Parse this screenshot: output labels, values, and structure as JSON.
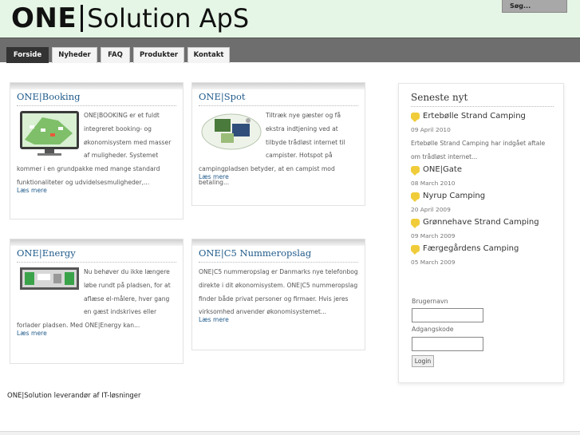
{
  "header": {
    "logo_bold": "ONE",
    "logo_rest": "Solution ApS",
    "search_label": "Søg..."
  },
  "nav": {
    "tabs": [
      {
        "label": "Forside",
        "active": true
      },
      {
        "label": "Nyheder",
        "active": false
      },
      {
        "label": "FAQ",
        "active": false
      },
      {
        "label": "Produkter",
        "active": false
      },
      {
        "label": "Kontakt",
        "active": false
      }
    ]
  },
  "products": [
    {
      "title": "ONE|Booking",
      "text": "ONE|BOOKING er et fuldt integreret booking- og økonomisystem med masser af muligheder. Systemet kommer i en grundpakke med mange standard funktionaliteter og udvidelsesmuligheder,...",
      "more": "Læs mere",
      "image": "booking-monitor-icon"
    },
    {
      "title": "ONE|Spot",
      "text": "Tiltræk nye gæster og få ekstra indtjening ved at tilbyde trådløst internet til campister. Hotspot på campingpladsen betyder, at en campist mod betaling...",
      "more": "Læs mere",
      "image": "spot-icon"
    },
    {
      "title": "ONE|Energy",
      "text": "Nu behøver du ikke længere løbe rundt på pladsen, for at aflæse el-målere, hver gang en gæst indskrives eller forlader pladsen. Med ONE|Energy kan...",
      "more": "Læs mere",
      "image": "energy-meter-icon"
    },
    {
      "title": "ONE|C5 Nummeropslag",
      "text": "ONE|C5 nummeropslag er Danmarks nye telefonbog direkte i dit økonomisystem. ONE|C5 nummeropslag finder både privat personer og firmaer. Hvis jeres virksomhed anvender økonomisystemet...",
      "more": "Læs mere"
    }
  ],
  "sidebar": {
    "title": "Seneste nyt",
    "news": [
      {
        "title": "Ertebølle Strand Camping",
        "date": "09 April 2010",
        "excerpt": "Ertebølle Strand Camping har indgået aftale om trådløst internet..."
      },
      {
        "title": "ONE|Gate",
        "date": "08 March 2010"
      },
      {
        "title": "Nyrup Camping",
        "date": "20 April 2009"
      },
      {
        "title": "Grønnehave Strand Camping",
        "date": "09 March 2009"
      },
      {
        "title": "Færgegårdens Camping",
        "date": "05 March 2009"
      }
    ],
    "login": {
      "username_label": "Brugernavn",
      "password_label": "Adgangskode",
      "button": "Login"
    }
  },
  "footer": {
    "text": "ONE|Solution leverandør af IT-løsninger"
  },
  "colors": {
    "header_bg": "#e6f6e6",
    "nav_bg": "#6e6e6e",
    "link": "#1f5a8a",
    "bubble": "#f0cc3a"
  }
}
